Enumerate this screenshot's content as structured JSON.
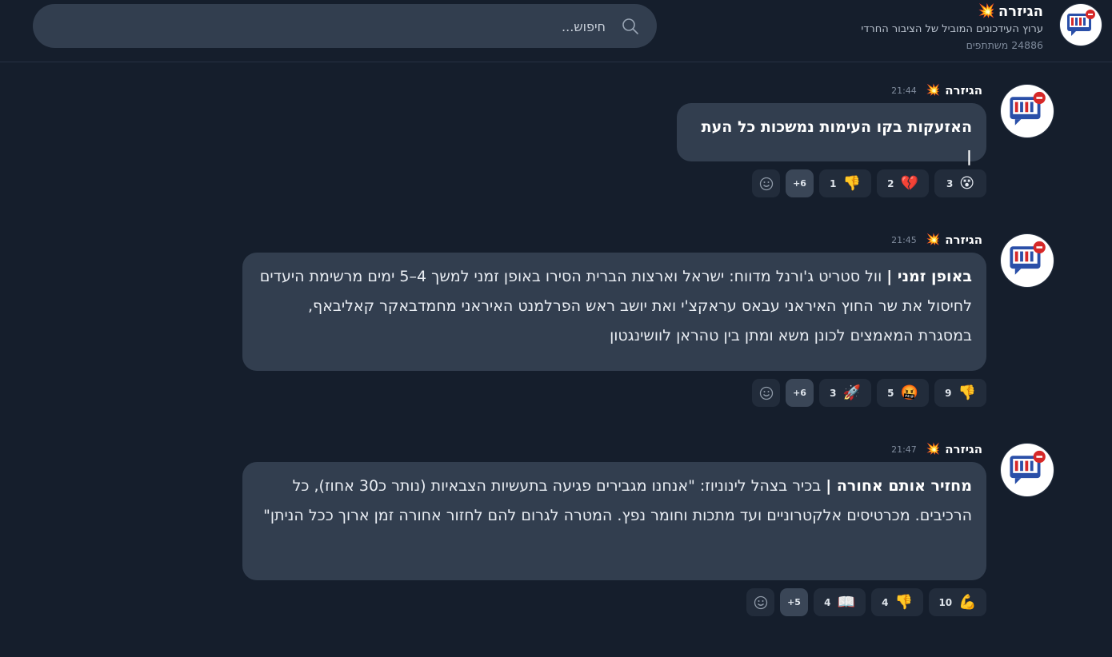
{
  "channel": {
    "title": "הגיזרה",
    "title_emoji": "💥",
    "description": "ערוץ העידכונים המוביל של הציבור החרדי",
    "subscribers": "24886 משתתפים"
  },
  "search": {
    "placeholder": "חיפוש..."
  },
  "colors": {
    "background": "#151e2c",
    "bubble": "#323e4f",
    "reaction": "#222c3b",
    "accent_red": "#d62828",
    "accent_blue": "#2a4fa8"
  },
  "messages": [
    {
      "sender": "הגיזרה",
      "sender_emoji": "💥",
      "time": "21:44",
      "bold": "האזעקות בקו העימות נמשכות כל העת |",
      "text": "",
      "reactions": [
        {
          "emoji": "😵",
          "count": "3"
        },
        {
          "emoji": "💔",
          "count": "2"
        },
        {
          "emoji": "👎",
          "count": "1"
        }
      ],
      "more": "+6"
    },
    {
      "sender": "הגיזרה",
      "sender_emoji": "💥",
      "time": "21:45",
      "bold": "באופן זמני |",
      "text": " וול סטריט ג'ורנל מדווח: ישראל וארצות הברית הסירו באופן זמני למשך 4–5 ימים מרשימת היעדים לחיסול את שר החוץ האיראני עבאס עראקצ'י ואת יושב ראש הפרלמנט האיראני מחמדבאקר קאליבאף, במסגרת המאמצים לכונן משא ומתן בין טהראן לוושינגטון",
      "reactions": [
        {
          "emoji": "👎",
          "count": "9"
        },
        {
          "emoji": "🤬",
          "count": "5"
        },
        {
          "emoji": "🚀",
          "count": "3"
        }
      ],
      "more": "+6"
    },
    {
      "sender": "הגיזרה",
      "sender_emoji": "💥",
      "time": "21:47",
      "bold": "מחזיר אותם אחורה |",
      "text": " בכיר בצהל לינוניוז: \"אנחנו מגבירים פגיעה בתעשיות הצבאיות (נותר כ30 אחוז), כל הרכיבים. מכרטיסים אלקטרוניים ועד מתכות וחומר נפץ. המטרה לגרום להם לחזור אחורה זמן ארוך ככל הניתן\"",
      "reactions": [
        {
          "emoji": "💪",
          "count": "10"
        },
        {
          "emoji": "👎",
          "count": "4"
        },
        {
          "emoji": "📖",
          "count": "4"
        }
      ],
      "more": "+5"
    }
  ]
}
